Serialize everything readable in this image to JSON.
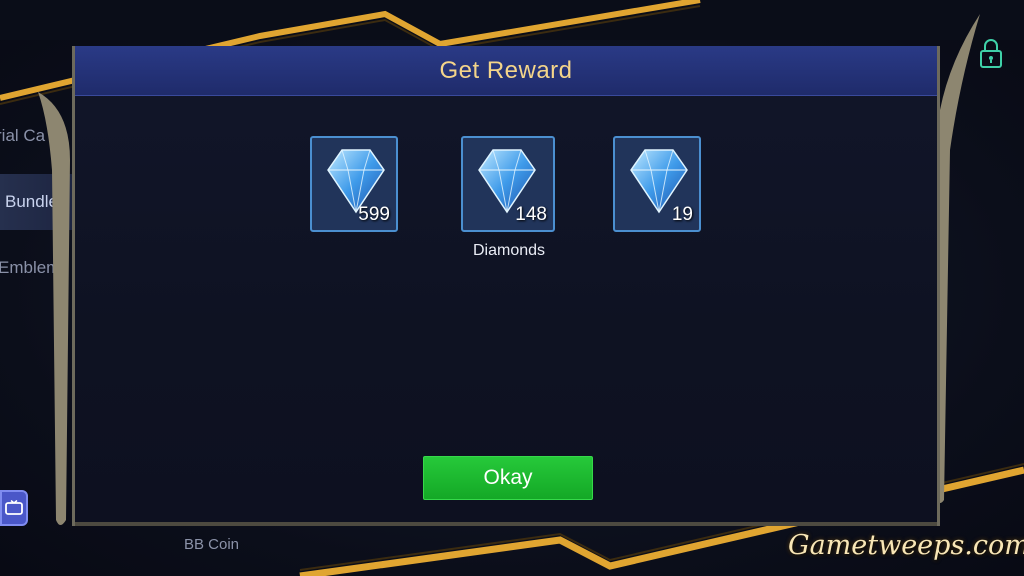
{
  "dialog": {
    "title": "Get Reward",
    "rewards": [
      {
        "icon": "diamond-icon",
        "quantity": "599"
      },
      {
        "icon": "diamond-icon",
        "quantity": "148"
      },
      {
        "icon": "diamond-icon",
        "quantity": "19"
      }
    ],
    "reward_name": "Diamonds",
    "okay_label": "Okay"
  },
  "background": {
    "side_menu": [
      "rial Ca",
      "Bundle",
      "Emblems"
    ],
    "bb_coin_label": "BB Coin"
  },
  "watermark": "Gametweeps.com",
  "colors": {
    "header": "#253477",
    "title_gold": "#f4d58a",
    "okay_green": "#1cb830",
    "gold_accent": "#d9a23a"
  }
}
